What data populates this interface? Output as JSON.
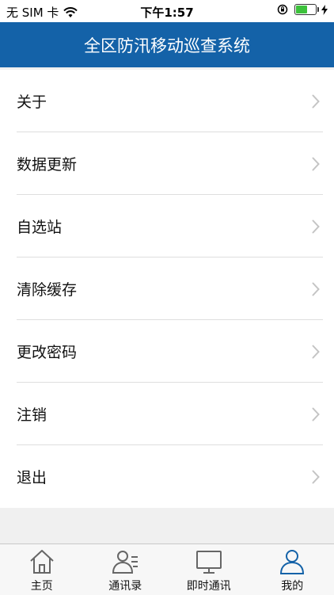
{
  "status_bar": {
    "carrier": "无 SIM 卡",
    "time": "下午1:57"
  },
  "header": {
    "title": "全区防汛移动巡查系统"
  },
  "menu": {
    "items": [
      {
        "label": "关于"
      },
      {
        "label": "数据更新"
      },
      {
        "label": "自选站"
      },
      {
        "label": "清除缓存"
      },
      {
        "label": "更改密码"
      },
      {
        "label": "注销"
      },
      {
        "label": "退出"
      }
    ]
  },
  "tabbar": {
    "items": [
      {
        "label": "主页",
        "icon": "home-icon"
      },
      {
        "label": "通讯录",
        "icon": "contacts-icon"
      },
      {
        "label": "即时通讯",
        "icon": "monitor-icon"
      },
      {
        "label": "我的",
        "icon": "user-icon"
      }
    ],
    "active_index": 3
  },
  "colors": {
    "header_bg": "#1462a8",
    "active_tab": "#1462a8"
  }
}
